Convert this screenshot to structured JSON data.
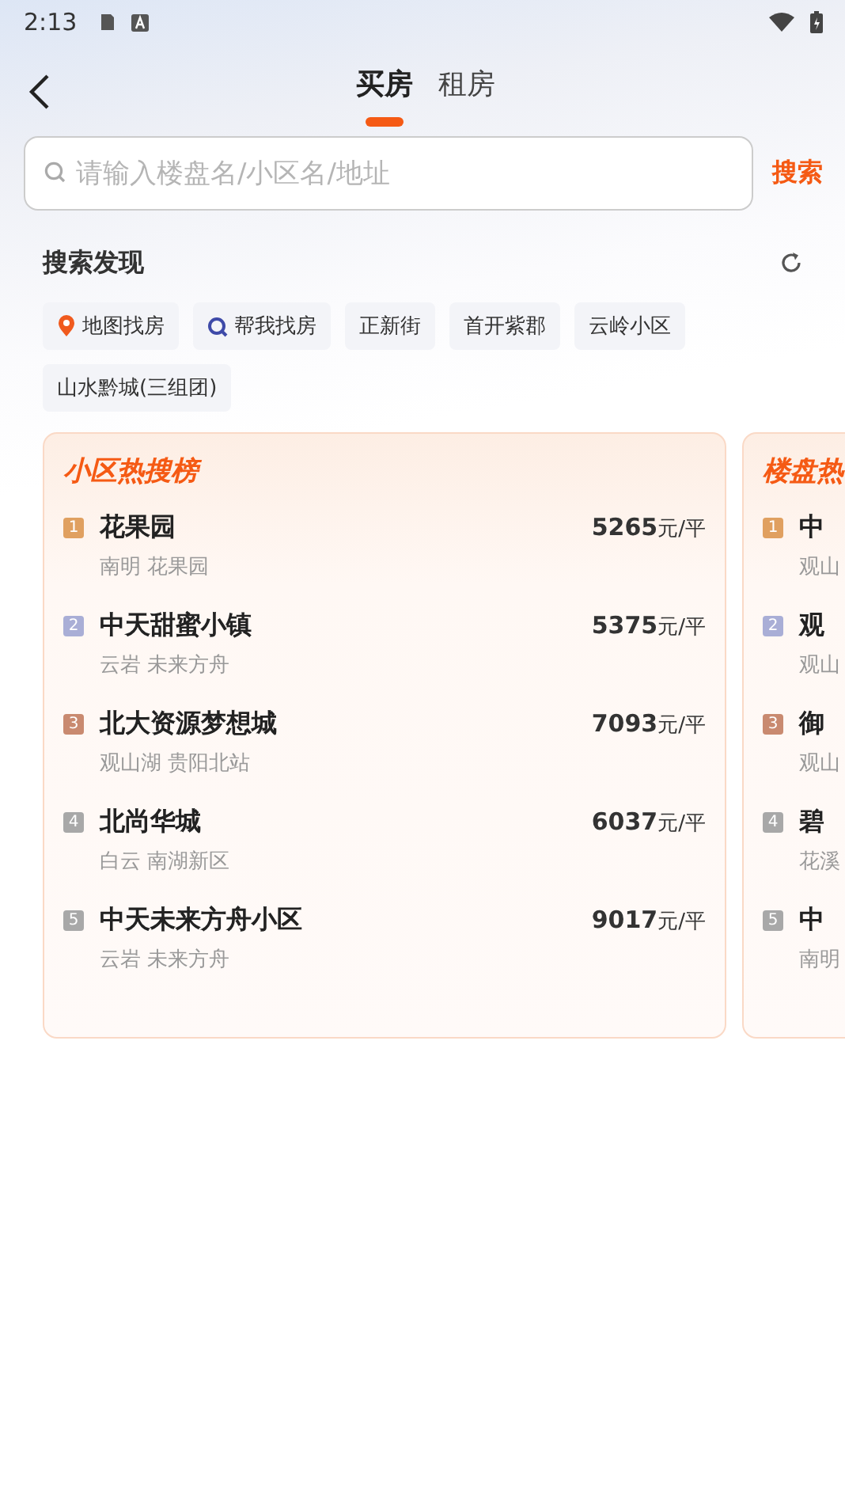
{
  "status_bar": {
    "time": "2:13"
  },
  "tabs": [
    {
      "label": "买房",
      "selected": true
    },
    {
      "label": "租房",
      "selected": false
    }
  ],
  "search": {
    "placeholder": "请输入楼盘名/小区名/地址",
    "button": "搜索"
  },
  "discover": {
    "title": "搜索发现",
    "tags": [
      {
        "label": "地图找房",
        "kind": "map"
      },
      {
        "label": "帮我找房",
        "kind": "search"
      },
      {
        "label": "正新街",
        "kind": "plain"
      },
      {
        "label": "首开紫郡",
        "kind": "plain"
      },
      {
        "label": "云岭小区",
        "kind": "plain"
      },
      {
        "label": "山水黔城(三组团)",
        "kind": "plain"
      }
    ]
  },
  "rankings": [
    {
      "title": "小区热搜榜",
      "items": [
        {
          "rank": "1",
          "color": "#e0a060",
          "name": "花果园",
          "sub": "南明 花果园",
          "price": "5265",
          "unit": "元/平"
        },
        {
          "rank": "2",
          "color": "#a9aed6",
          "name": "中天甜蜜小镇",
          "sub": "云岩 未来方舟",
          "price": "5375",
          "unit": "元/平"
        },
        {
          "rank": "3",
          "color": "#c98a70",
          "name": "北大资源梦想城",
          "sub": "观山湖 贵阳北站",
          "price": "7093",
          "unit": "元/平"
        },
        {
          "rank": "4",
          "color": "#a8a8a8",
          "name": "北尚华城",
          "sub": "白云 南湖新区",
          "price": "6037",
          "unit": "元/平"
        },
        {
          "rank": "5",
          "color": "#a8a8a8",
          "name": "中天未来方舟小区",
          "sub": "云岩 未来方舟",
          "price": "9017",
          "unit": "元/平"
        }
      ]
    },
    {
      "title": "楼盘热",
      "items": [
        {
          "rank": "1",
          "color": "#e0a060",
          "name": "中",
          "sub": "观山"
        },
        {
          "rank": "2",
          "color": "#a9aed6",
          "name": "观",
          "sub": "观山"
        },
        {
          "rank": "3",
          "color": "#c98a70",
          "name": "御",
          "sub": "观山"
        },
        {
          "rank": "4",
          "color": "#a8a8a8",
          "name": "碧",
          "sub": "花溪"
        },
        {
          "rank": "5",
          "color": "#a8a8a8",
          "name": "中",
          "sub": "南明"
        }
      ]
    }
  ]
}
